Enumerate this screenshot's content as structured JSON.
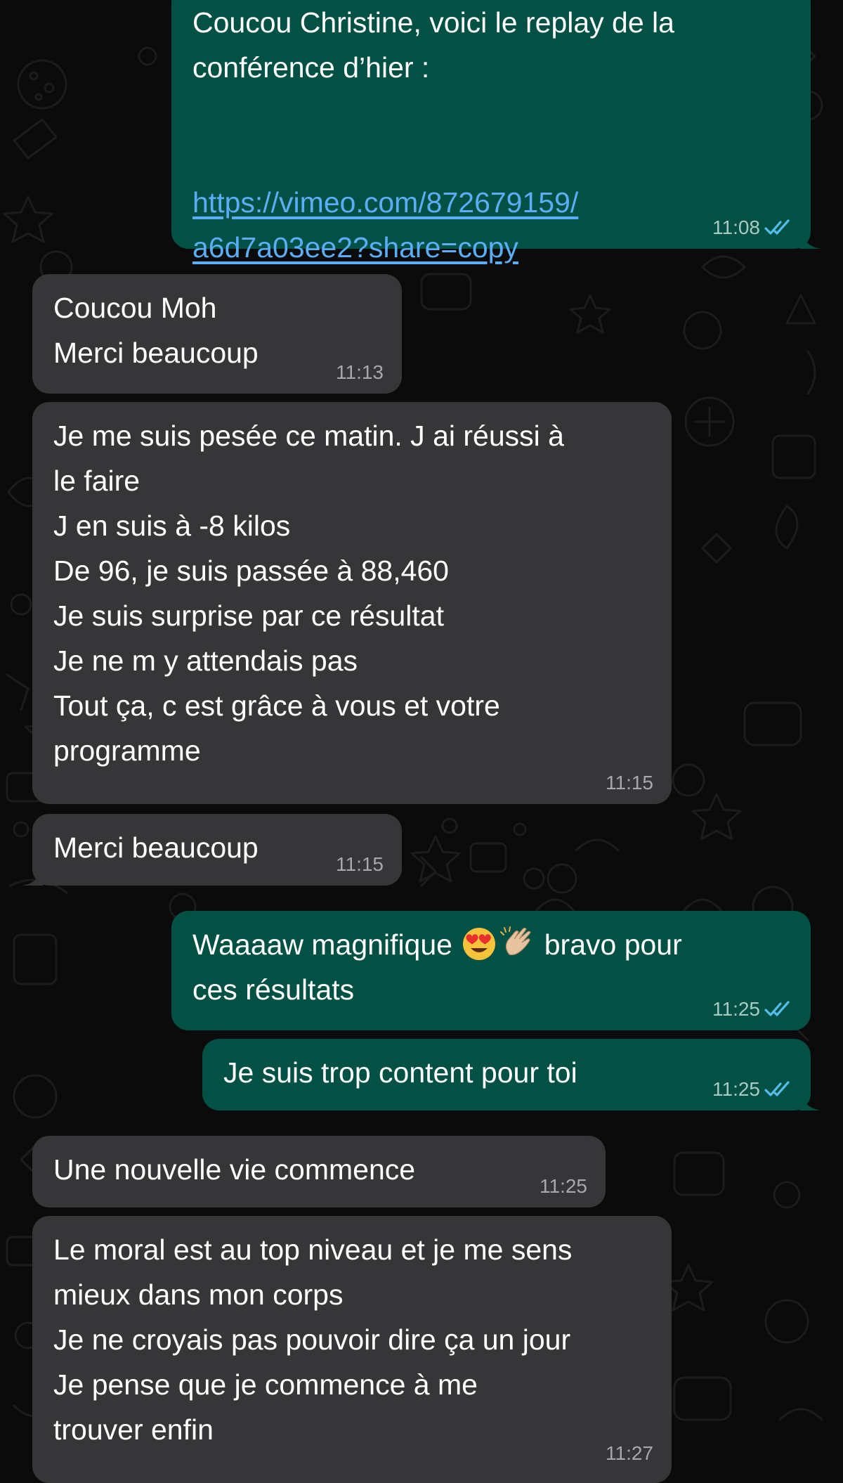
{
  "messages": [
    {
      "id": "m1",
      "direction": "out",
      "line1": "Coucou Christine, voici le replay de la",
      "line2": "conférence d’hier :",
      "link_line1": "https://vimeo.com/872679159/",
      "link_line2": "a6d7a03ee2?share=copy",
      "time": "11:08",
      "status": "read"
    },
    {
      "id": "m2",
      "direction": "in",
      "text": "Coucou Moh\nMerci beaucoup",
      "time": "11:13"
    },
    {
      "id": "m3",
      "direction": "in",
      "text": "Je me suis pesée ce matin. J ai réussi à\nle faire\nJ en suis à -8 kilos\nDe 96, je suis passée à 88,460\nJe suis surprise par ce résultat\nJe ne m y attendais pas\nTout ça,  c est grâce à vous et votre\nprogramme",
      "time": "11:15"
    },
    {
      "id": "m4",
      "direction": "in",
      "text": "Merci beaucoup",
      "time": "11:15"
    },
    {
      "id": "m5",
      "direction": "out",
      "part1": "Waaaaw magnifique ",
      "emoji1": "heart-eyes-emoji",
      "emoji2": "clapping-hands-emoji",
      "part2": " bravo pour",
      "line2": "ces résultats",
      "time": "11:25",
      "status": "read"
    },
    {
      "id": "m6",
      "direction": "out",
      "text": "Je suis trop content pour toi",
      "time": "11:25",
      "status": "read"
    },
    {
      "id": "m7",
      "direction": "in",
      "text": "Une nouvelle vie commence",
      "time": "11:25"
    },
    {
      "id": "m8",
      "direction": "in",
      "text": "Le moral est au top niveau et je me sens\nmieux dans mon corps\nJe ne croyais pas pouvoir dire ça un jour\nJe pense que je commence à me\ntrouver enfin",
      "time": "11:27"
    }
  ],
  "colors": {
    "background": "#0b0b0b",
    "incoming_bubble": "#363638",
    "outgoing_bubble": "#025144",
    "link": "#5aaef8",
    "read_ticks": "#53bdeb"
  }
}
